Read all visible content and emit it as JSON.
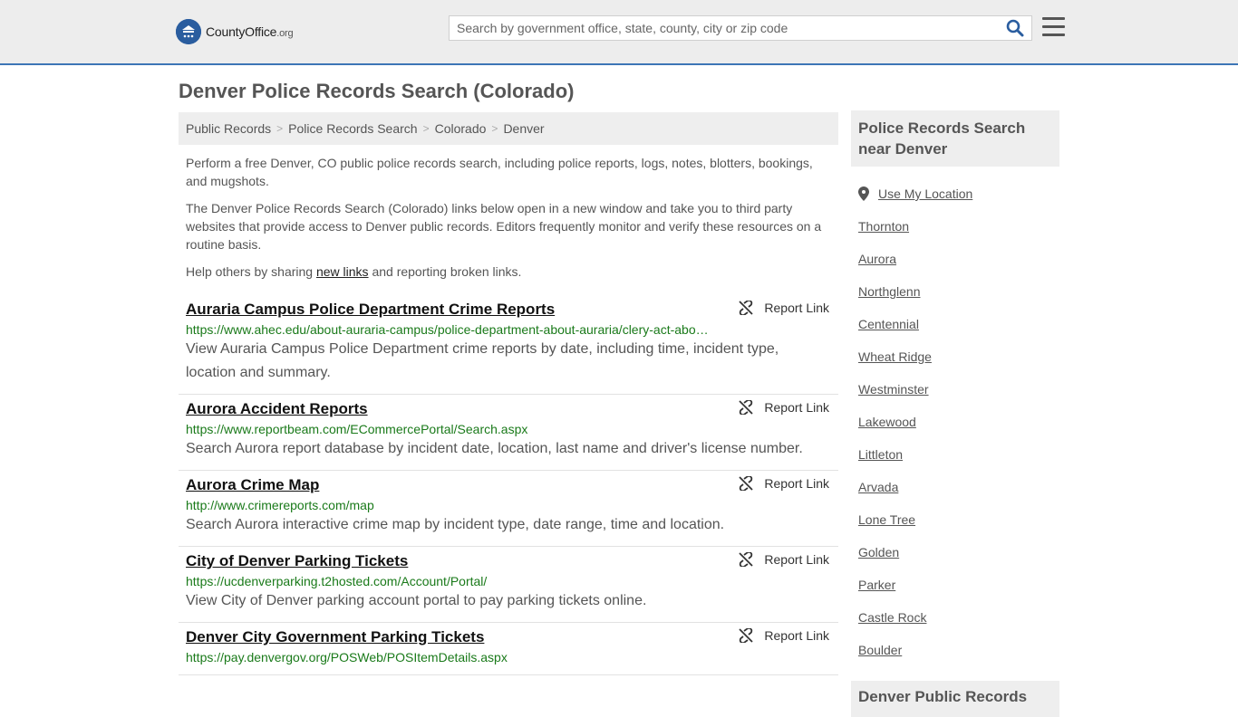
{
  "header": {
    "logo_main": "CountyOffice",
    "logo_suffix": ".org",
    "search_placeholder": "Search by government office, state, county, city or zip code"
  },
  "page": {
    "title": "Denver Police Records Search (Colorado)"
  },
  "breadcrumb": [
    "Public Records",
    "Police Records Search",
    "Colorado",
    "Denver"
  ],
  "intro": {
    "p1": "Perform a free Denver, CO public police records search, including police reports, logs, notes, blotters, bookings, and mugshots.",
    "p2": "The Denver Police Records Search (Colorado) links below open in a new window and take you to third party websites that provide access to Denver public records. Editors frequently monitor and verify these resources on a routine basis.",
    "p3_before": "Help others by sharing ",
    "p3_link": "new links",
    "p3_after": " and reporting broken links."
  },
  "report_label": "Report Link",
  "results": [
    {
      "title": "Auraria Campus Police Department Crime Reports",
      "url": "https://www.ahec.edu/about-auraria-campus/police-department-about-auraria/clery-act-abo…",
      "desc": "View Auraria Campus Police Department crime reports by date, including time, incident type, location and summary."
    },
    {
      "title": "Aurora Accident Reports",
      "url": "https://www.reportbeam.com/ECommercePortal/Search.aspx",
      "desc": "Search Aurora report database by incident date, location, last name and driver's license number."
    },
    {
      "title": "Aurora Crime Map",
      "url": "http://www.crimereports.com/map",
      "desc": "Search Aurora interactive crime map by incident type, date range, time and location."
    },
    {
      "title": "City of Denver Parking Tickets",
      "url": "https://ucdenverparking.t2hosted.com/Account/Portal/",
      "desc": "View City of Denver parking account portal to pay parking tickets online."
    },
    {
      "title": "Denver City Government Parking Tickets",
      "url": "https://pay.denvergov.org/POSWeb/POSItemDetails.aspx",
      "desc": ""
    }
  ],
  "sidebar": {
    "heading": "Police Records Search near Denver",
    "use_location": "Use My Location",
    "cities": [
      "Thornton",
      "Aurora",
      "Northglenn",
      "Centennial",
      "Wheat Ridge",
      "Westminster",
      "Lakewood",
      "Littleton",
      "Arvada",
      "Lone Tree",
      "Golden",
      "Parker",
      "Castle Rock",
      "Boulder"
    ],
    "heading2": "Denver Public Records"
  },
  "colors": {
    "accent": "#3d76b6",
    "url_green": "#1a7a1a",
    "panel_gray": "#eeeeee"
  }
}
